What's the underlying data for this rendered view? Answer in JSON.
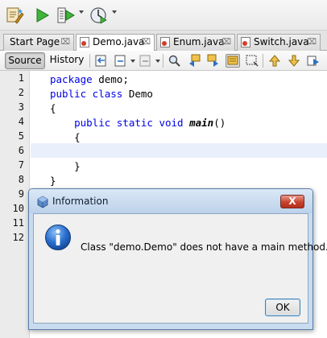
{
  "toolbar": {
    "icons": [
      "clean-build-icon",
      "run-icon",
      "profile-icon",
      "debug-icon"
    ]
  },
  "tabs": [
    {
      "label": "Start Page",
      "close": "⌧",
      "active": false
    },
    {
      "label": "Demo.java",
      "close": "⌧",
      "active": true
    },
    {
      "label": "Enum.java",
      "close": "⌧",
      "active": false
    },
    {
      "label": "Switch.java",
      "close": "⌧",
      "active": false
    }
  ],
  "editor_toolbar": {
    "source_label": "Source",
    "history_label": "History"
  },
  "gutter": {
    "line_numbers": [
      "1",
      "2",
      "3",
      "4",
      "5",
      "6",
      "7",
      "8",
      "9",
      "10",
      "11",
      "12"
    ]
  },
  "code": {
    "line1_kw": "package",
    "line1_rest": " demo;",
    "line2_kw": "public class",
    "line2_rest": " Demo",
    "line3": "{",
    "line4_kw": "    public static void",
    "line4_method": "main",
    "line4_rest": "()",
    "line5": "    {",
    "line7": "    }",
    "line8": "}"
  },
  "dialog": {
    "title": "Information",
    "close_label": "X",
    "message": "Class \"demo.Demo\" does not have a main method.",
    "ok_label": "OK"
  },
  "colors": {
    "keyword": "#0000e6",
    "current_line": "#e9effb",
    "dialog_frame": "#c9dbef",
    "close_button": "#c8432f"
  }
}
